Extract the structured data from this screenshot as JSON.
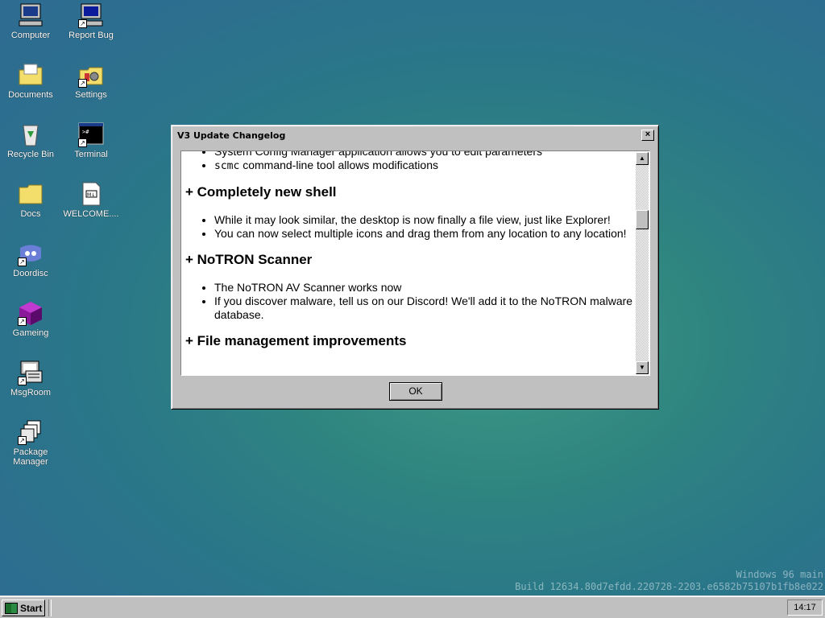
{
  "desktop_icons": [
    {
      "label": "Computer",
      "icon": "computer-icon"
    },
    {
      "label": "Report Bug",
      "icon": "report-bug-icon"
    },
    {
      "label": "Documents",
      "icon": "documents-folder-icon"
    },
    {
      "label": "Settings",
      "icon": "settings-icon"
    },
    {
      "label": "Recycle Bin",
      "icon": "recycle-bin-icon"
    },
    {
      "label": "Terminal",
      "icon": "terminal-icon"
    },
    {
      "label": "Docs",
      "icon": "folder-icon"
    },
    {
      "label": "WELCOME....",
      "icon": "markdown-file-icon"
    },
    {
      "label": "Doordisc",
      "icon": "doordisc-icon"
    },
    {
      "label": "Gameing",
      "icon": "gameing-cube-icon"
    },
    {
      "label": "MsgRoom",
      "icon": "msgroom-icon"
    },
    {
      "label": "Package Manager",
      "icon": "package-manager-icon"
    }
  ],
  "window": {
    "title": "V3 Update Changelog",
    "close_label": "×",
    "ok_label": "OK",
    "changelog": {
      "item_cut": "System Config Manager application allows you to edit parameters",
      "scmc_code": "scmc",
      "scmc_text": " command-line tool allows modifications",
      "section1": "+ Completely new shell",
      "s1_item1": "While it may look similar, the desktop is now finally a file view, just like Explorer!",
      "s1_item2": "You can now select multiple icons and drag them from any location to any location!",
      "section2": "+ NoTRON Scanner",
      "s2_item1": "The NoTRON AV Scanner works now",
      "s2_item2": "If you discover malware, tell us on our Discord! We'll add it to the NoTRON malware database.",
      "section3": "+ File management improvements"
    }
  },
  "taskbar": {
    "start_label": "Start",
    "clock": "14:17"
  },
  "watermark": {
    "line1": "Windows 96 main",
    "line2": "Build 12634.80d7efdd.220728-2203.e6582b75107b1fb8e022"
  }
}
